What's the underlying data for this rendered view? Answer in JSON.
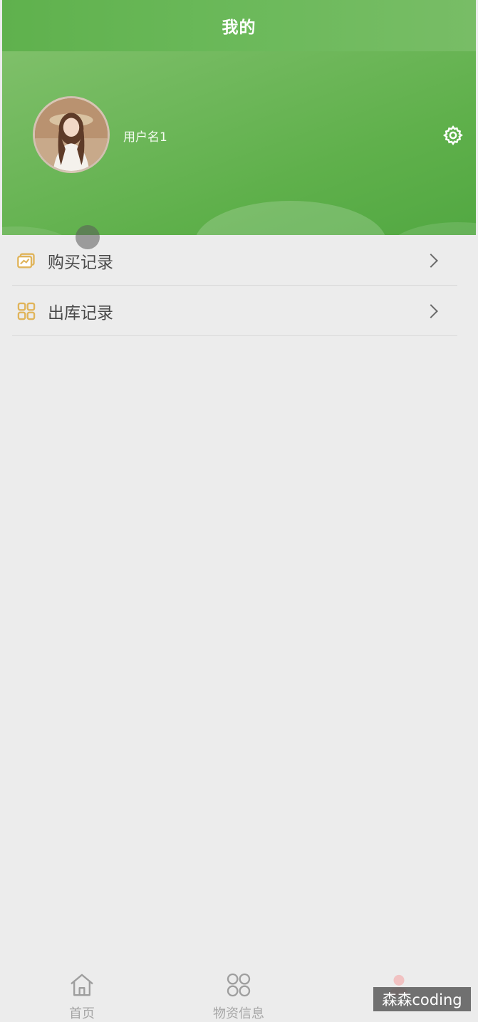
{
  "header": {
    "title": "我的"
  },
  "profile": {
    "username": "用户名1"
  },
  "menu": {
    "items": [
      {
        "label": "购买记录",
        "icon": "purchase-record-icon"
      },
      {
        "label": "出库记录",
        "icon": "outbound-record-icon"
      }
    ]
  },
  "tabbar": {
    "tabs": [
      {
        "label": "首页",
        "icon": "home-icon"
      },
      {
        "label": "物资信息",
        "icon": "grid-icon"
      },
      {
        "label": "",
        "icon": "profile-icon"
      }
    ]
  },
  "watermark": {
    "text": "森森coding"
  },
  "colors": {
    "primary_green": "#5fb04b",
    "menu_icon_gold": "#e0b45a",
    "text_gray": "#4a4a4a",
    "tab_gray": "#a5a5a5",
    "background": "#ececec"
  }
}
